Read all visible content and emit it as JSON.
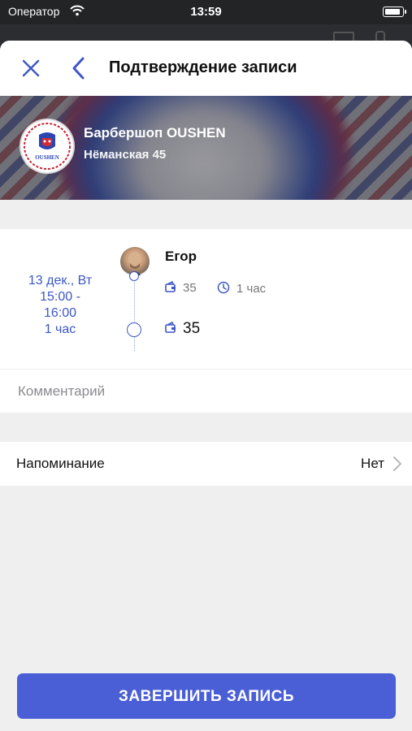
{
  "status_bar": {
    "carrier": "Оператор",
    "time": "13:59"
  },
  "nav": {
    "title": "Подтверждение записи",
    "close_icon": "close-icon",
    "back_icon": "chevron-left-icon"
  },
  "shop": {
    "name": "Барбершоп OUSHEN",
    "address": "Нёманская 45",
    "logo_text": "OUSHEN"
  },
  "booking": {
    "date": "13 дек., Вт",
    "time_range": "15:00 - 16:00",
    "duration_short": "1 час",
    "master": "Егор",
    "service_price": "35",
    "service_duration": "1 час",
    "total_price": "35"
  },
  "comment": {
    "placeholder": "Комментарий",
    "value": ""
  },
  "reminder": {
    "label": "Напоминание",
    "value": "Нет"
  },
  "finish_button": {
    "label": "ЗАВЕРШИТЬ ЗАПИСЬ"
  },
  "colors": {
    "accent": "#3d57c5",
    "button": "#4a5fd6",
    "sheet_bg": "#efeff0"
  }
}
